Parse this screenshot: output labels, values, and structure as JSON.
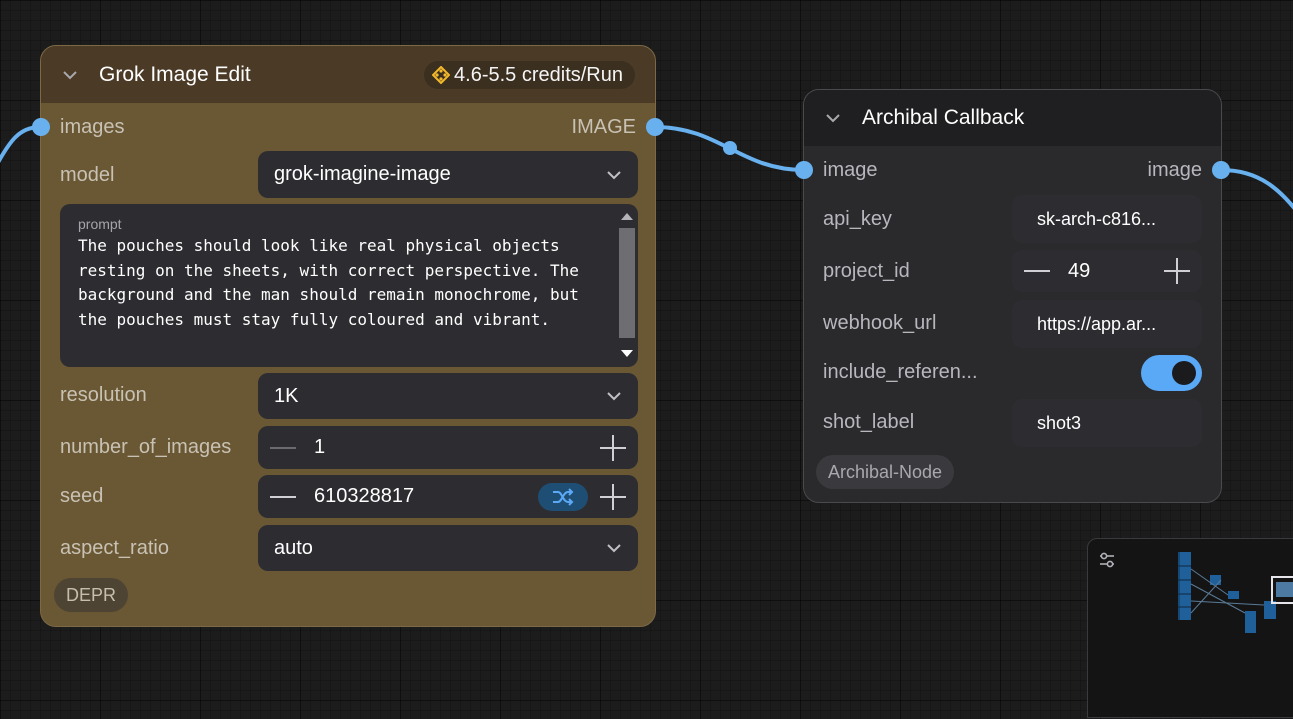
{
  "grok_node": {
    "title": "Grok Image Edit",
    "credits": "4.6-5.5 credits/Run",
    "input_label": "images",
    "output_label": "IMAGE",
    "model": {
      "label": "model",
      "value": "grok-imagine-image"
    },
    "prompt": {
      "label": "prompt",
      "value": "The pouches should look like real physical objects resting on the sheets, with correct perspective. The background and the man should remain monochrome, but the pouches must stay fully coloured and vibrant."
    },
    "resolution": {
      "label": "resolution",
      "value": "1K"
    },
    "number_of_images": {
      "label": "number_of_images",
      "value": "1"
    },
    "seed": {
      "label": "seed",
      "value": "610328817"
    },
    "aspect_ratio": {
      "label": "aspect_ratio",
      "value": "auto"
    },
    "badge": "DEPR"
  },
  "archibal_node": {
    "title": "Archibal Callback",
    "input_label": "image",
    "output_label": "image",
    "api_key": {
      "label": "api_key",
      "value": "sk-arch-c816..."
    },
    "project_id": {
      "label": "project_id",
      "value": "49"
    },
    "webhook_url": {
      "label": "webhook_url",
      "value": "https://app.ar..."
    },
    "include_reference": {
      "label": "include_referen...",
      "enabled": true
    },
    "shot_label": {
      "label": "shot_label",
      "value": "shot3"
    },
    "badge": "Archibal-Node"
  },
  "colors": {
    "link": "#68b1ee",
    "accent_toggle": "#5aa9f7",
    "grok_body": "#6a5734",
    "grok_header": "#4b3a26",
    "credits_icon": "#f2b92a"
  },
  "icons": [
    "chevron-down-icon",
    "credits-icon",
    "shuffle-icon",
    "plus-icon",
    "minus-icon",
    "settings-sliders-icon"
  ]
}
